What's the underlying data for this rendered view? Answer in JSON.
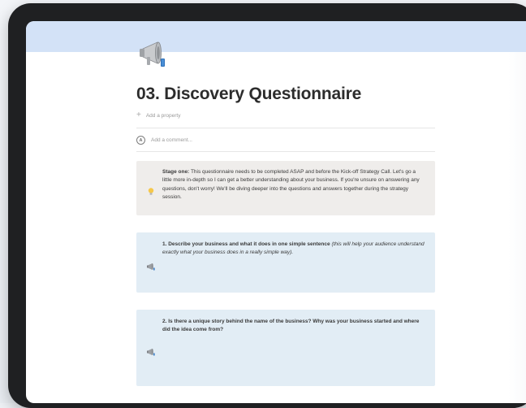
{
  "page": {
    "title": "03. Discovery Questionnaire",
    "icon": "megaphone-icon",
    "cover_color": "#d3e2f7"
  },
  "properties": {
    "add_property_label": "Add a property",
    "add_comment_label": "Add a comment..."
  },
  "stage_callout": {
    "icon": "lightbulb-icon",
    "label": "Stage one:",
    "text": "This questionnaire needs to be completed ASAP and before the Kick-off Strategy Call. Let's go a little more in-depth so I can get a better understanding about your business. If you're unsure on answering any questions, don't worry! We'll be diving deeper into the questions and answers together during the strategy session.",
    "background": "#efedeb"
  },
  "questions": [
    {
      "icon": "megaphone-icon",
      "main": "1. Describe your business and what it does in one simple sentence",
      "note": "(this will help your audience understand exactly what your business does in a really simple way)."
    },
    {
      "icon": "megaphone-icon",
      "main": "2. Is there a unique story behind the name of the business? Why was your business started and where did the idea come from?",
      "note": ""
    }
  ],
  "colors": {
    "question_background": "#e2edf5",
    "device_frame": "#1f2022"
  }
}
